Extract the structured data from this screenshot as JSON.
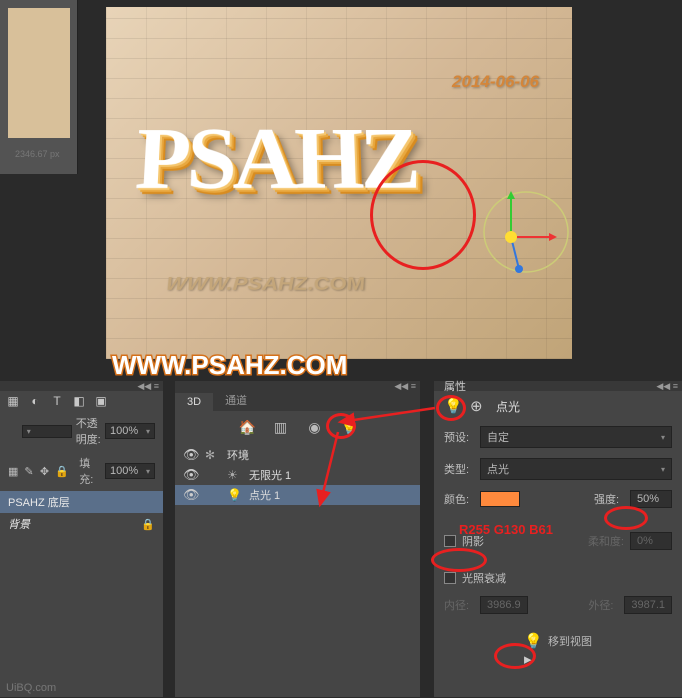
{
  "canvas": {
    "date": "2014-06-06",
    "text3d": "PSAHZ",
    "suburl": "WWW.PSAHZ.COM"
  },
  "watermark": "WWW.PSAHZ.COM",
  "thumb": {
    "label": "2346.67 px"
  },
  "layers": {
    "opacity_label": "不透明度:",
    "opacity_value": "100%",
    "fill_label": "填充:",
    "fill_value": "100%",
    "lock_label": "锁定:",
    "item1": "PSAHZ 底层",
    "item2": "背景"
  },
  "d3": {
    "tab1": "3D",
    "tab2": "通道",
    "env": "环境",
    "light1": "无限光 1",
    "light2": "点光 1"
  },
  "props": {
    "panel": "属性",
    "title": "点光",
    "preset_lbl": "预设:",
    "preset_val": "自定",
    "type_lbl": "类型:",
    "type_val": "点光",
    "color_lbl": "颜色:",
    "intensity_lbl": "强度:",
    "intensity_val": "50%",
    "shadow_lbl": "阴影",
    "softness_lbl": "柔和度:",
    "softness_val": "0%",
    "falloff_lbl": "光照衰减",
    "inner_lbl": "内径:",
    "inner_val": "3986.9",
    "outer_lbl": "外径:",
    "outer_val": "3987.1",
    "move_lbl": "移到视图"
  },
  "annot": {
    "color_code": "R255 G130 B61"
  },
  "footer": "UiBQ.com"
}
